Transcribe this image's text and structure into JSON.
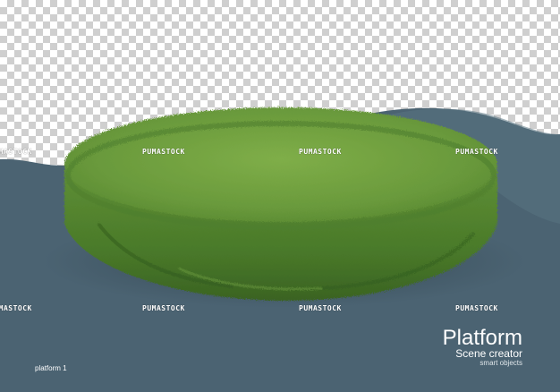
{
  "watermark": "PUMASTOCK",
  "title": "Platform",
  "subtitle": "Scene creator",
  "tagline": "smart objects",
  "caption": "platform 1",
  "colors": {
    "backdrop": "#4b6372",
    "backdrop_light": "#5a7482",
    "grass_top": "#6a9a3c",
    "grass_side": "#4f7f2c",
    "grass_dark": "#2f5a1c"
  }
}
